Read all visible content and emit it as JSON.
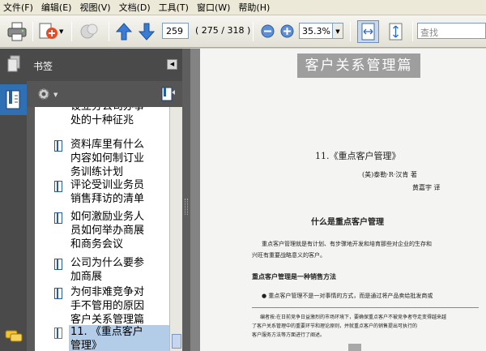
{
  "menu": [
    "文件(F)",
    "编辑(E)",
    "视图(V)",
    "文档(D)",
    "工具(T)",
    "窗口(W)",
    "帮助(H)"
  ],
  "toolbar": {
    "page_number": "259",
    "page_count": "( 275 / 318 )",
    "zoom": "35.3%",
    "search_placeholder": "查找"
  },
  "bookmarks": {
    "title": "书签",
    "items": [
      {
        "label_lines": [
          "设立分公司办事",
          "处的十种征兆"
        ],
        "selected": false
      },
      {
        "label_lines": [
          "资料库里有什么",
          "内容如何制订业",
          "务训练计划"
        ],
        "selected": false
      },
      {
        "label_lines": [
          "评论受训业务员",
          "销售拜访的清单"
        ],
        "selected": false
      },
      {
        "label_lines": [
          "如何激励业务人",
          "员如何举办商展",
          "和商务会议"
        ],
        "selected": false
      },
      {
        "label_lines": [
          "公司为什么要参",
          "加商展"
        ],
        "selected": false
      },
      {
        "label_lines": [
          "为何非难竞争对",
          "手不管用的原因",
          "客户关系管理篇"
        ],
        "selected": false
      },
      {
        "label_lines": [
          "11. 《重点客户",
          "管理》"
        ],
        "selected": true
      }
    ]
  },
  "document": {
    "banner": "客户关系管理篇",
    "chapter_title": "11.《重点客户管理》",
    "author": "(美)泰勒·R·汉肯  著",
    "translator": "黄嘉宇  译",
    "section_heading": "什么是重点客户管理",
    "para1_line1": "重点客户管理就是有计划、有步骤地开发和培育那些对企业的生存和",
    "para1_line2": "兴旺有重要战略意义的客户。",
    "subheading": "重点客户管理是一种销售方法",
    "bullet_line": "● 重点客户管理不是一对事情的方式，而是通过将产品卖给批发商或",
    "note_line1": "编者按:在日前竞争日益激烈的市场环境下，要确保重点客户不被竞争者夺走变得越来越",
    "note_line2": "了客户关系管理中的重要环节和理论原则，并就重点客户的销售提出可执行的",
    "note_line3": "客户服务方法等方面进行了阐述。"
  }
}
